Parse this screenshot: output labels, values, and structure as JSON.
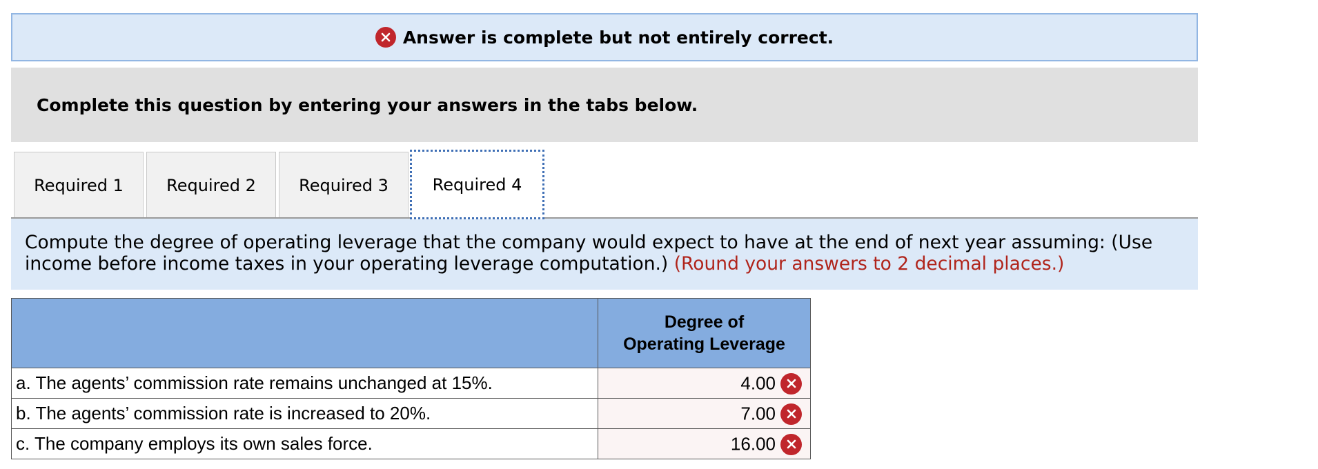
{
  "banner": {
    "message": "Answer is complete but not entirely correct.",
    "icon": "x-circle-icon",
    "icon_color": "#c0262c"
  },
  "instruction": "Complete this question by entering your answers in the tabs below.",
  "tabs": [
    {
      "label": "Required 1",
      "active": false
    },
    {
      "label": "Required 2",
      "active": false
    },
    {
      "label": "Required 3",
      "active": false
    },
    {
      "label": "Required 4",
      "active": true
    }
  ],
  "question": {
    "text": "Compute the degree of operating leverage that the company would expect to have at the end of next year assuming: (Use income before income taxes in your operating leverage computation.)",
    "note": "(Round your answers to 2 decimal places.)",
    "note_color": "#b0241b"
  },
  "table": {
    "header_line1": "Degree of",
    "header_line2": "Operating Leverage",
    "header_color": "#84acdf",
    "rows": [
      {
        "label": "a. The agents’ commission rate remains unchanged at 15%.",
        "value": "4.00",
        "status": "incorrect"
      },
      {
        "label": "b. The agents’ commission rate is increased to 20%.",
        "value": "7.00",
        "status": "incorrect"
      },
      {
        "label": "c. The company employs its own sales force.",
        "value": "16.00",
        "status": "incorrect"
      }
    ]
  }
}
